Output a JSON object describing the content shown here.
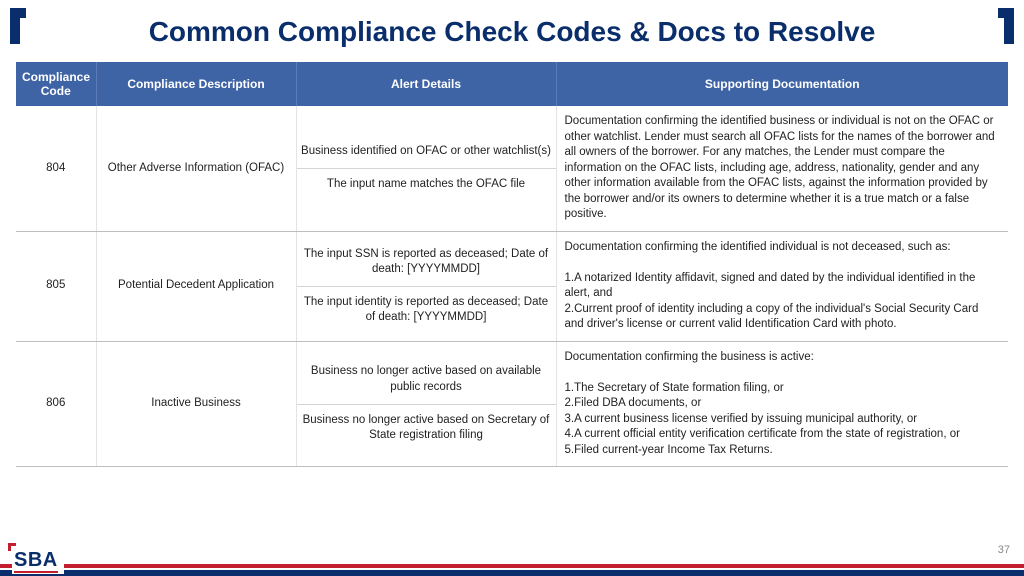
{
  "title": "Common Compliance Check Codes & Docs to Resolve",
  "columns": {
    "code": "Compliance Code",
    "desc": "Compliance Description",
    "alert": "Alert Details",
    "doc": "Supporting Documentation"
  },
  "rows": [
    {
      "code": "804",
      "desc": "Other Adverse Information (OFAC)",
      "alerts": [
        "Business identified on OFAC or other watchlist(s)",
        "The input name matches the OFAC file"
      ],
      "doc": "Documentation confirming the identified business or individual is not on the OFAC or other watchlist. Lender must search all OFAC lists for the names of the borrower and all owners of the borrower. For any matches, the Lender must compare the information on the OFAC lists, including age, address, nationality, gender and any other information available from the OFAC lists, against the information provided by the borrower and/or its owners to determine whether it is a true match or a false positive."
    },
    {
      "code": "805",
      "desc": "Potential Decedent Application",
      "alerts": [
        "The input SSN is reported as deceased; Date of death: [YYYYMMDD]",
        "The input identity is reported as deceased; Date of death: [YYYYMMDD]"
      ],
      "doc": "Documentation confirming the identified individual is not deceased, such as:\n\n1.A notarized Identity affidavit, signed and dated by the individual identified in the alert, and\n2.Current proof of identity including a copy of the individual's Social Security Card and driver's license or current valid Identification Card with photo."
    },
    {
      "code": "806",
      "desc": "Inactive Business",
      "alerts": [
        "Business no longer active based on available public records",
        "Business no longer active based on Secretary of State registration filing"
      ],
      "doc": "Documentation confirming the business is active:\n\n1.The Secretary of State formation filing, or\n2.Filed DBA documents, or\n3.A current business license verified by issuing municipal authority, or\n4.A current official entity verification certificate from the state of registration, or\n5.Filed current-year Income Tax Returns."
    }
  ],
  "page_number": "37",
  "logo_text": "SBA"
}
